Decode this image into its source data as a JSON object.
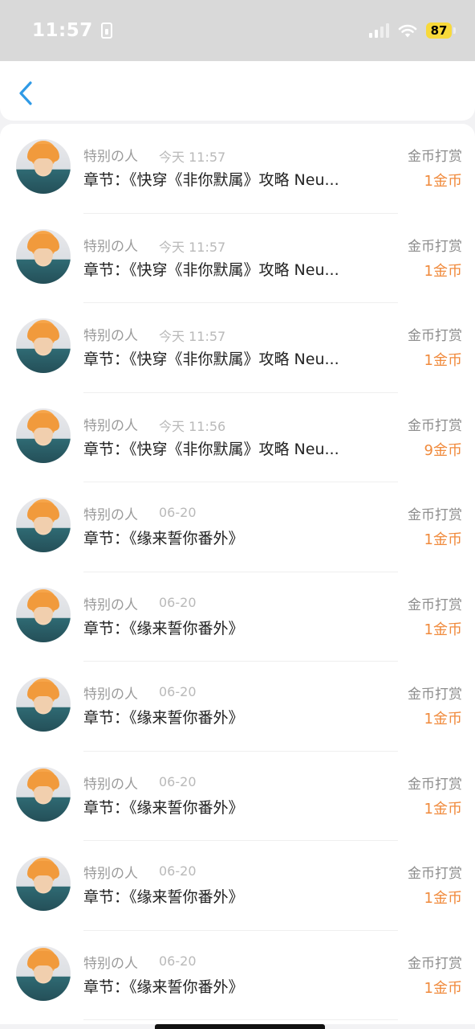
{
  "status_bar": {
    "time": "11:57",
    "battery": "87",
    "battery_color": "#f8d93a"
  },
  "nav": {
    "back_icon": "chevron-left-icon",
    "accent_color": "#2f9ae6"
  },
  "colors": {
    "amount": "#f08a3c",
    "secondary_text": "#9b9b9b"
  },
  "rows": [
    {
      "username": "特别の人",
      "time": "今天 11:57",
      "chapter": "章节：《快穿《非你默属》攻略 Neu...",
      "reward_type": "金币打赏",
      "amount": "1金币"
    },
    {
      "username": "特别の人",
      "time": "今天 11:57",
      "chapter": "章节：《快穿《非你默属》攻略 Neu...",
      "reward_type": "金币打赏",
      "amount": "1金币"
    },
    {
      "username": "特别の人",
      "time": "今天 11:57",
      "chapter": "章节：《快穿《非你默属》攻略 Neu...",
      "reward_type": "金币打赏",
      "amount": "1金币"
    },
    {
      "username": "特别の人",
      "time": "今天 11:56",
      "chapter": "章节：《快穿《非你默属》攻略 Neu...",
      "reward_type": "金币打赏",
      "amount": "9金币"
    },
    {
      "username": "特别の人",
      "time": "06-20",
      "chapter": "章节：《缘来誓你番外》",
      "reward_type": "金币打赏",
      "amount": "1金币"
    },
    {
      "username": "特别の人",
      "time": "06-20",
      "chapter": "章节：《缘来誓你番外》",
      "reward_type": "金币打赏",
      "amount": "1金币"
    },
    {
      "username": "特别の人",
      "time": "06-20",
      "chapter": "章节：《缘来誓你番外》",
      "reward_type": "金币打赏",
      "amount": "1金币"
    },
    {
      "username": "特别の人",
      "time": "06-20",
      "chapter": "章节：《缘来誓你番外》",
      "reward_type": "金币打赏",
      "amount": "1金币"
    },
    {
      "username": "特别の人",
      "time": "06-20",
      "chapter": "章节：《缘来誓你番外》",
      "reward_type": "金币打赏",
      "amount": "1金币"
    },
    {
      "username": "特别の人",
      "time": "06-20",
      "chapter": "章节：《缘来誓你番外》",
      "reward_type": "金币打赏",
      "amount": "1金币"
    }
  ]
}
